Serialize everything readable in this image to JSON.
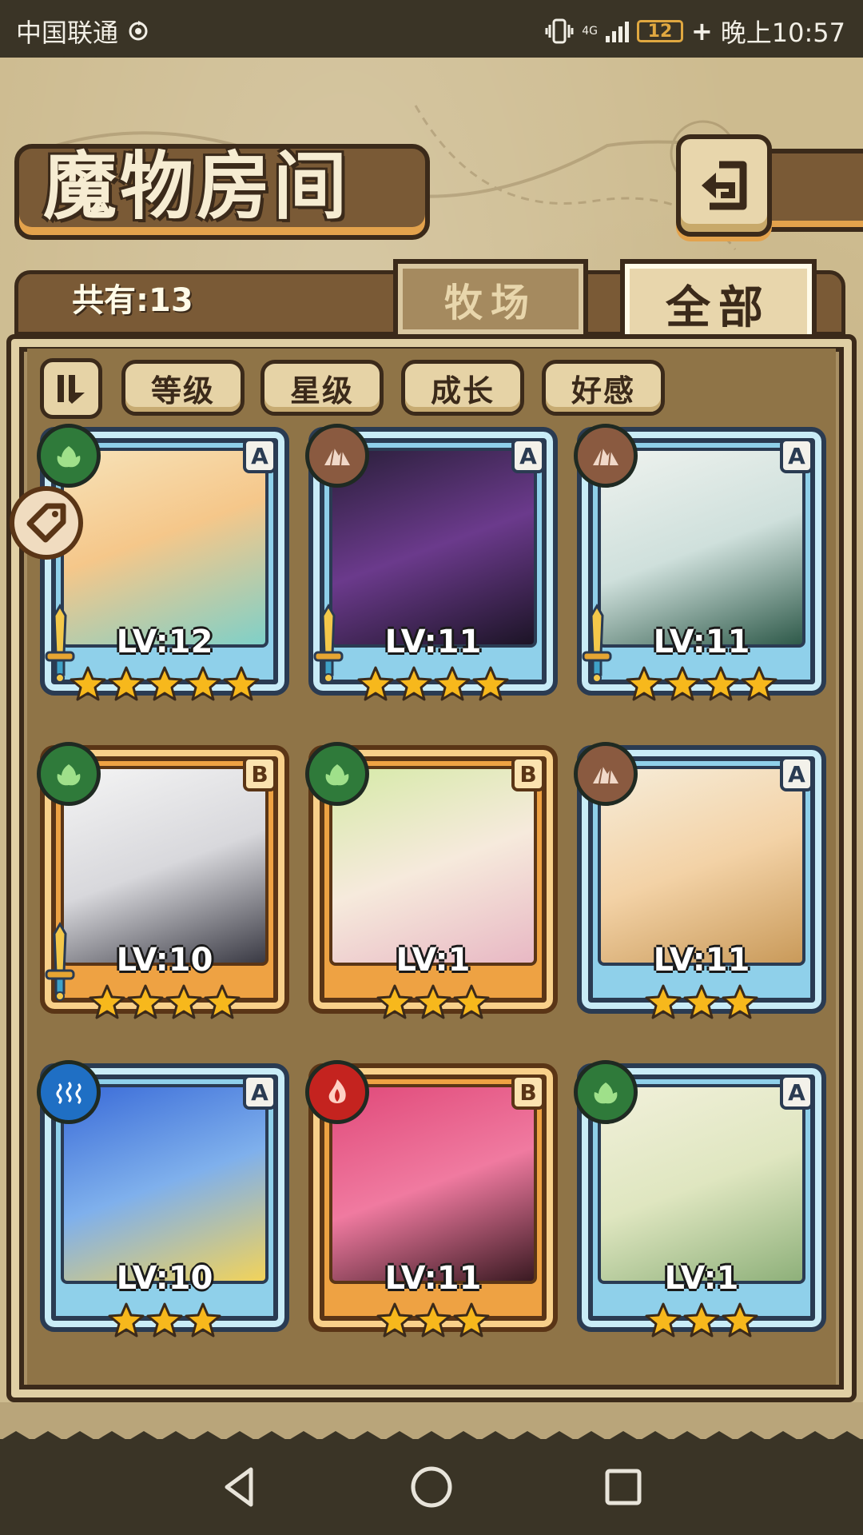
{
  "status_bar": {
    "carrier": "中国联通",
    "network": "4G",
    "battery": "12",
    "time": "晚上10:57"
  },
  "header": {
    "title": "魔物房间",
    "back_icon": "back-arrow-icon"
  },
  "tabs": {
    "count_label": "共有:13",
    "ranch": "牧场",
    "all": "全部",
    "active": "全部"
  },
  "sort_buttons": {
    "toggle_icon": "sort-order-icon",
    "level": "等级",
    "star": "星级",
    "growth": "成长",
    "affection": "好感"
  },
  "monsters": [
    {
      "grade": "A",
      "element": "nature",
      "level": "LV:12",
      "stars": 5,
      "frame": "blue",
      "weapon": true
    },
    {
      "grade": "A",
      "element": "earth",
      "level": "LV:11",
      "stars": 4,
      "frame": "blue",
      "weapon": true
    },
    {
      "grade": "A",
      "element": "earth",
      "level": "LV:11",
      "stars": 4,
      "frame": "blue",
      "weapon": true
    },
    {
      "grade": "B",
      "element": "nature",
      "level": "LV:10",
      "stars": 4,
      "frame": "orange",
      "weapon": true
    },
    {
      "grade": "B",
      "element": "nature",
      "level": "LV:1",
      "stars": 3,
      "frame": "orange",
      "weapon": false
    },
    {
      "grade": "A",
      "element": "earth",
      "level": "LV:11",
      "stars": 3,
      "frame": "blue",
      "weapon": false
    },
    {
      "grade": "A",
      "element": "water",
      "level": "LV:10",
      "stars": 3,
      "frame": "blue",
      "weapon": false
    },
    {
      "grade": "B",
      "element": "fire",
      "level": "LV:11",
      "stars": 3,
      "frame": "orange",
      "weapon": false
    },
    {
      "grade": "A",
      "element": "nature",
      "level": "LV:1",
      "stars": 3,
      "frame": "blue",
      "weapon": false
    }
  ],
  "colors": {
    "nature": "#2f7a3a",
    "earth": "#8a5a40",
    "water": "#1f6fc4",
    "fire": "#c4231f",
    "star": "#f7b81c"
  }
}
